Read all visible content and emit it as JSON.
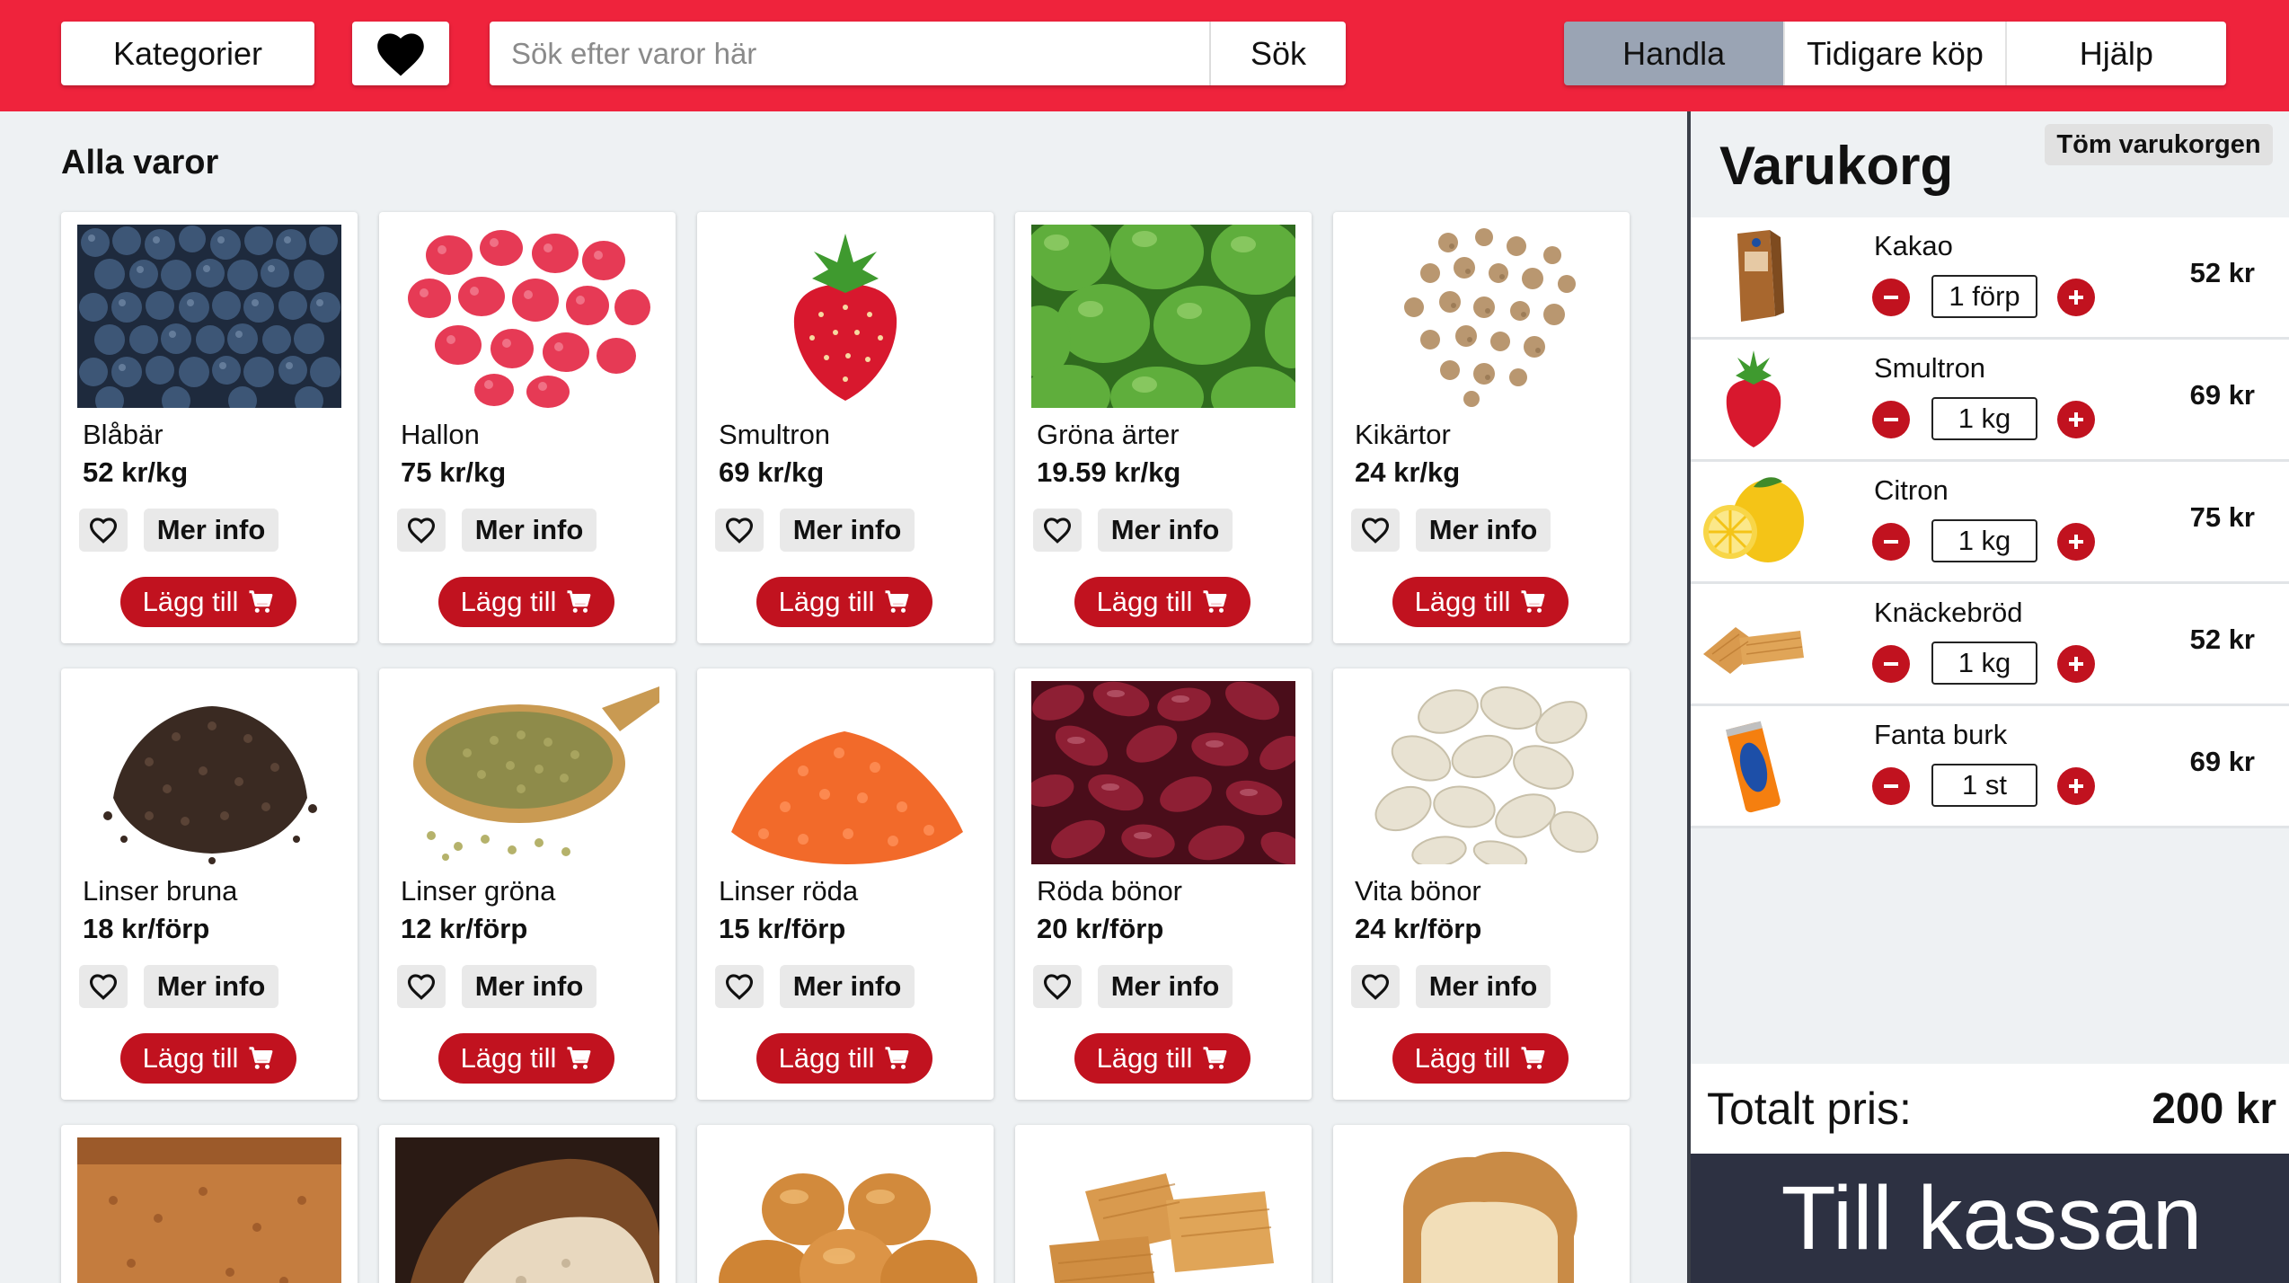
{
  "header": {
    "categories_label": "Kategorier",
    "search_placeholder": "Sök efter varor här",
    "search_button": "Sök",
    "nav": [
      {
        "label": "Handla",
        "active": true
      },
      {
        "label": "Tidigare köp",
        "active": false
      },
      {
        "label": "Hjälp",
        "active": false
      }
    ]
  },
  "main": {
    "title": "Alla varor",
    "info_label": "Mer info",
    "add_label": "Lägg till",
    "products": [
      {
        "name": "Blåbär",
        "price": "52 kr/kg",
        "image": "blueberries"
      },
      {
        "name": "Hallon",
        "price": "75 kr/kg",
        "image": "raspberries"
      },
      {
        "name": "Smultron",
        "price": "69 kr/kg",
        "image": "wild-strawberry"
      },
      {
        "name": "Gröna ärter",
        "price": "19.59 kr/kg",
        "image": "green-peas"
      },
      {
        "name": "Kikärtor",
        "price": "24 kr/kg",
        "image": "chickpeas"
      },
      {
        "name": "Linser bruna",
        "price": "18 kr/förp",
        "image": "brown-lentils"
      },
      {
        "name": "Linser gröna",
        "price": "12 kr/förp",
        "image": "green-lentils"
      },
      {
        "name": "Linser röda",
        "price": "15 kr/förp",
        "image": "red-lentils"
      },
      {
        "name": "Röda bönor",
        "price": "20 kr/förp",
        "image": "kidney-beans"
      },
      {
        "name": "Vita bönor",
        "price": "24 kr/förp",
        "image": "white-beans"
      }
    ],
    "partial_products": [
      {
        "image": "rye-bread"
      },
      {
        "image": "sourdough-bread"
      },
      {
        "image": "bread-rolls"
      },
      {
        "image": "crispbread"
      },
      {
        "image": "white-loaf"
      }
    ]
  },
  "cart": {
    "title": "Varukorg",
    "empty_label": "Töm varukorgen",
    "items": [
      {
        "name": "Kakao",
        "qty": "1 förp",
        "price": "52 kr",
        "image": "cocoa-box"
      },
      {
        "name": "Smultron",
        "qty": "1 kg",
        "price": "69 kr",
        "image": "wild-strawberry"
      },
      {
        "name": "Citron",
        "qty": "1 kg",
        "price": "75 kr",
        "image": "lemon"
      },
      {
        "name": "Knäckebröd",
        "qty": "1 kg",
        "price": "52 kr",
        "image": "crispbread"
      },
      {
        "name": "Fanta burk",
        "qty": "1 st",
        "price": "69 kr",
        "image": "fanta-can"
      }
    ],
    "total_label": "Totalt pris:",
    "total_value": "200 kr",
    "checkout_label": "Till kassan"
  },
  "colors": {
    "topbar": "#ef233c",
    "accent": "#c1121f",
    "active_tab": "#9aa4b4",
    "checkout": "#2d3142"
  }
}
